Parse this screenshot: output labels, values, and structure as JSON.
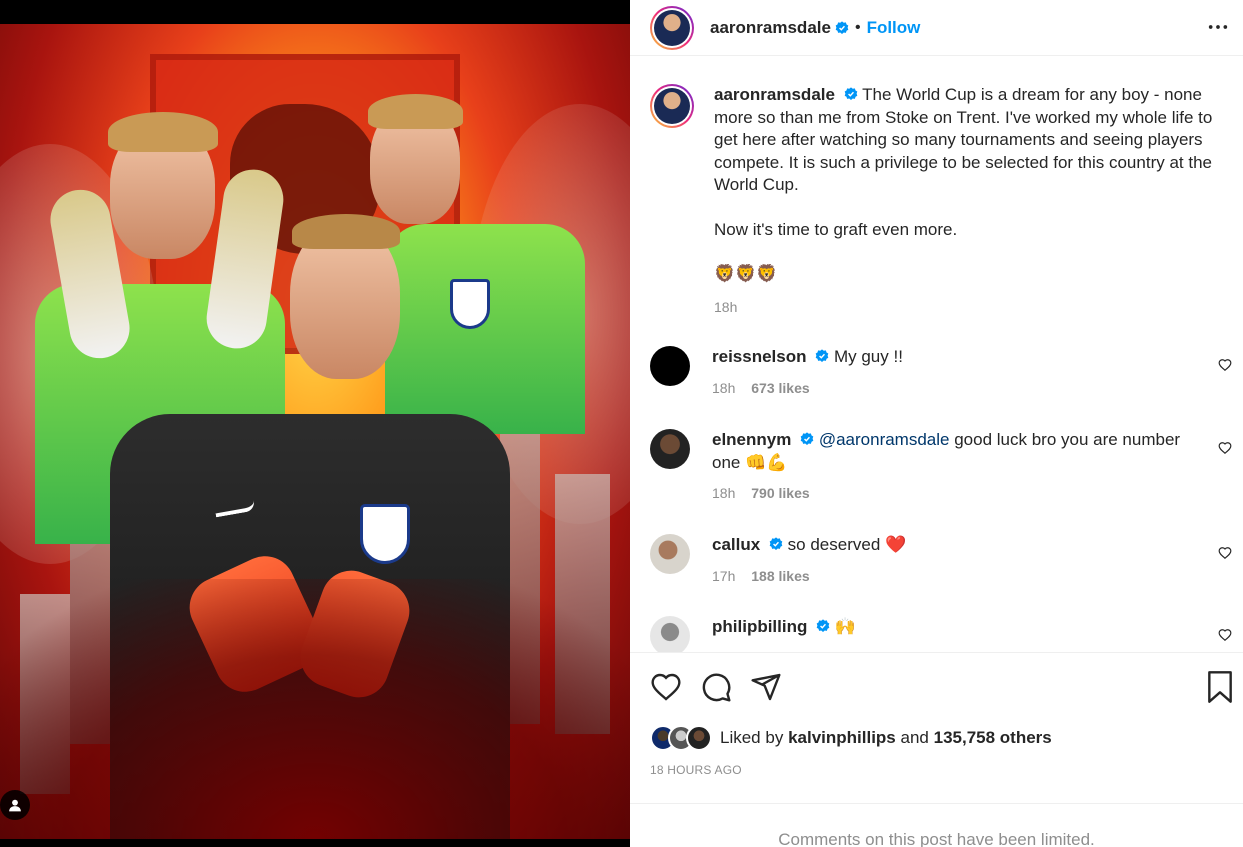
{
  "post": {
    "username": "aaronramsdale",
    "follow_label": "Follow",
    "separator": "•",
    "caption_line1": "The World Cup is a dream for any boy - none more so than me from Stoke on Trent. I've worked my whole life to get here after watching so many tournaments and seeing players compete. It is such a privilege to be selected for this country at the World Cup.",
    "caption_line2": "Now it's time to graft even more.",
    "caption_emojis": "🦁🦁🦁",
    "caption_time": "18h"
  },
  "comments": [
    {
      "username": "reissnelson",
      "text": "My guy !!",
      "time": "18h",
      "likes": "673 likes"
    },
    {
      "username": "elnennym",
      "mention": "@aaronramsdale",
      "text": " good luck bro you are number one 👊💪",
      "time": "18h",
      "likes": "790 likes"
    },
    {
      "username": "callux",
      "text": "so deserved ❤️",
      "time": "17h",
      "likes": "188 likes"
    },
    {
      "username": "philipbilling",
      "text": "🙌"
    }
  ],
  "likes": {
    "prefix": "Liked by",
    "user": "kalvinphillips",
    "conjunction": "and",
    "others": "135,758 others"
  },
  "timestamp": "18 HOURS AGO",
  "comments_limited": "Comments on this post have been limited.",
  "colors": {
    "link_blue": "#0095f6",
    "verified_blue": "#0095f6",
    "muted": "#8e8e8e",
    "heart_red": "#ed4956"
  }
}
